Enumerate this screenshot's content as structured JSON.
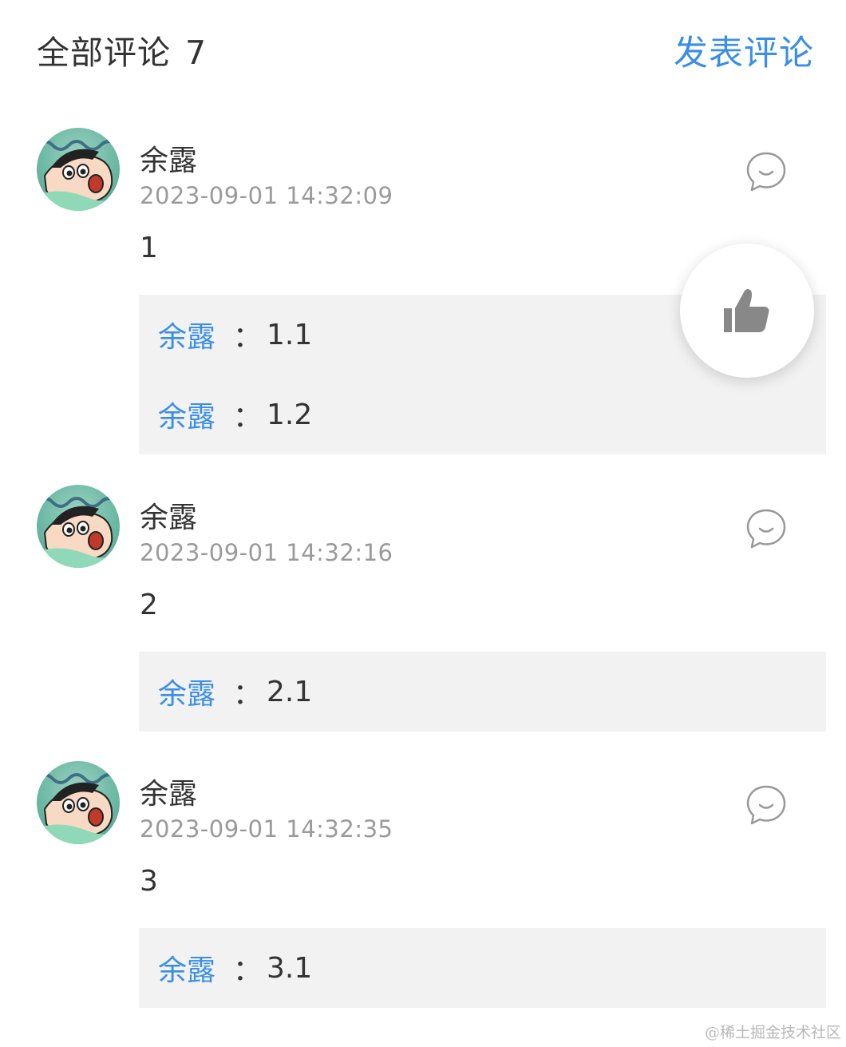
{
  "header": {
    "title": "全部评论",
    "count": "7",
    "post_button": "发表评论"
  },
  "comments": [
    {
      "username": "余露",
      "time": "2023-09-01 14:32:09",
      "content": "1",
      "replies": [
        {
          "user": "余露",
          "sep": "：",
          "text": "1.1"
        },
        {
          "user": "余露",
          "sep": "：",
          "text": "1.2"
        }
      ]
    },
    {
      "username": "余露",
      "time": "2023-09-01 14:32:16",
      "content": "2",
      "replies": [
        {
          "user": "余露",
          "sep": "：",
          "text": "2.1"
        }
      ]
    },
    {
      "username": "余露",
      "time": "2023-09-01 14:32:35",
      "content": "3",
      "replies": [
        {
          "user": "余露",
          "sep": "：",
          "text": "3.1"
        }
      ]
    }
  ],
  "icons": {
    "reply": "comment-bubble-icon",
    "like": "thumbs-up-icon"
  },
  "colors": {
    "accent": "#3a8ee6",
    "text": "#333333",
    "muted": "#9a9a9a",
    "reply_bg": "#f2f2f2",
    "like_icon": "#888888"
  },
  "watermark": "@稀土掘金技术社区"
}
